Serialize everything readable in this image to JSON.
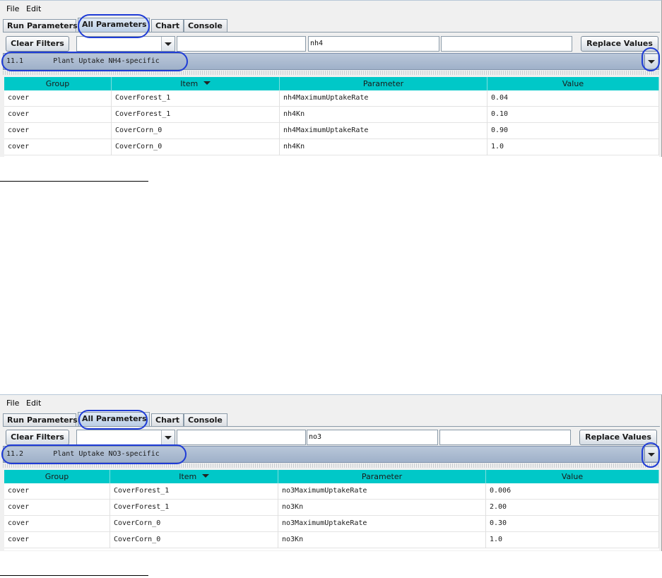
{
  "menu": {
    "file_label": "File",
    "edit_label": "Edit"
  },
  "tabs": [
    "Run Parameters",
    "All Parameters",
    "Chart",
    "Console"
  ],
  "toolbar": {
    "clear_filters_label": "Clear Filters",
    "replace_values_label": "Replace Values"
  },
  "table_headers": [
    "Group",
    "Item",
    "Parameter",
    "Value"
  ],
  "annotation_color": "#1f3cd6",
  "header_color": "#00c8c8",
  "screens": [
    {
      "filter_value": "nh4",
      "section": "11.1       Plant Uptake NH4-specific",
      "rows": [
        [
          "cover",
          "CoverForest_1",
          "nh4MaximumUptakeRate",
          "0.04"
        ],
        [
          "cover",
          "CoverForest_1",
          "nh4Kn",
          "0.10"
        ],
        [
          "cover",
          "CoverCorn_0",
          "nh4MaximumUptakeRate",
          "0.90"
        ],
        [
          "cover",
          "CoverCorn_0",
          "nh4Kn",
          "1.0"
        ]
      ]
    },
    {
      "filter_value": "no3",
      "section": "11.2       Plant Uptake NO3-specific",
      "rows": [
        [
          "cover",
          "CoverForest_1",
          "no3MaximumUptakeRate",
          "0.006"
        ],
        [
          "cover",
          "CoverForest_1",
          "no3Kn",
          "2.00"
        ],
        [
          "cover",
          "CoverCorn_0",
          "no3MaximumUptakeRate",
          "0.30"
        ],
        [
          "cover",
          "CoverCorn_0",
          "no3Kn",
          "1.0"
        ]
      ]
    }
  ]
}
